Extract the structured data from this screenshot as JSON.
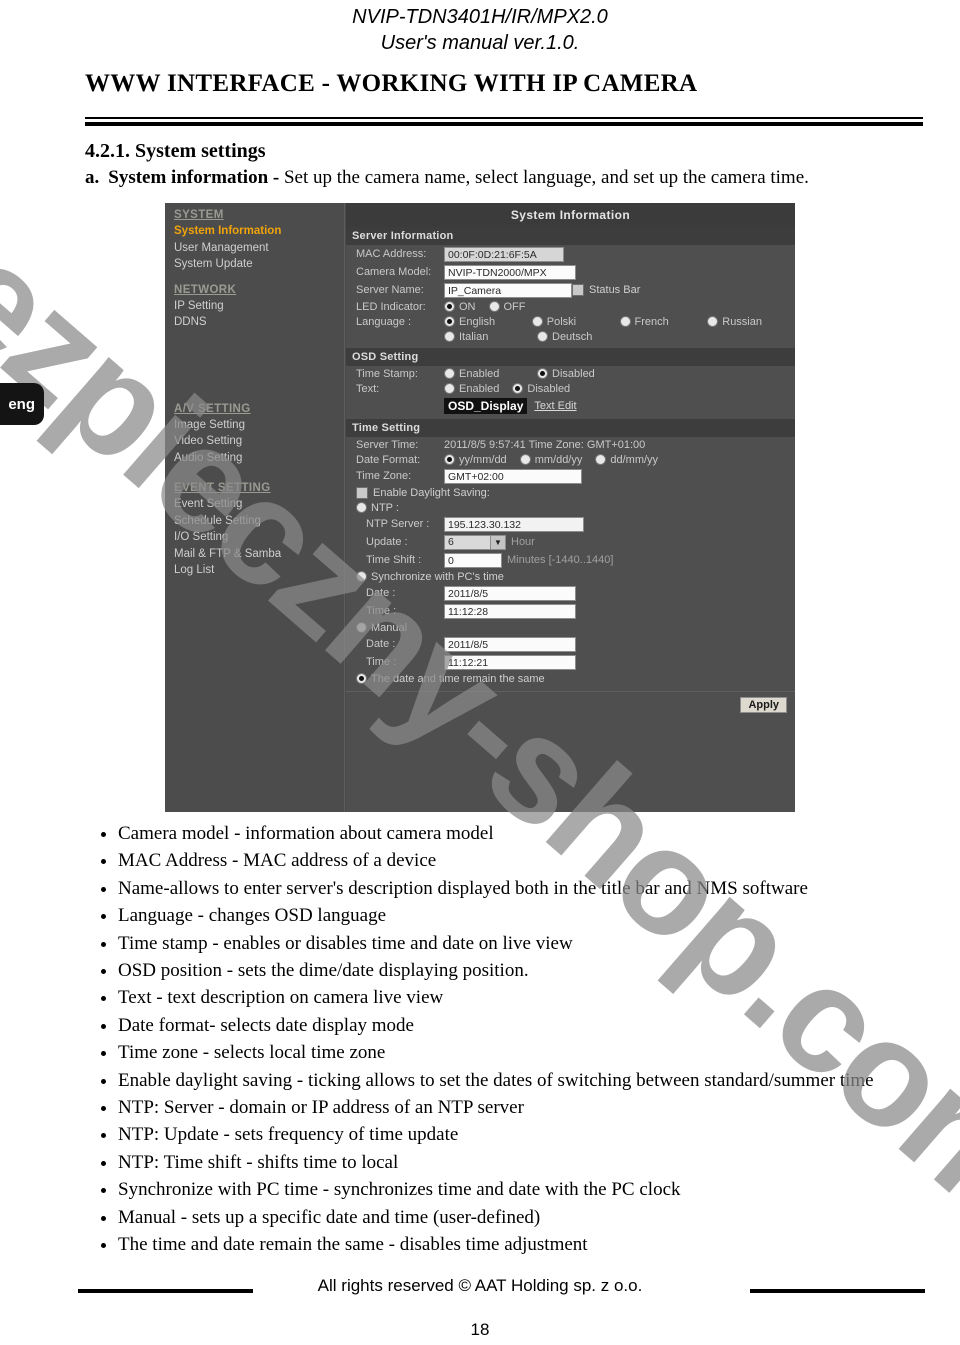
{
  "document": {
    "header_line1": "NVIP-TDN3401H/IR/MPX2.0",
    "header_line2": "User's manual ver.1.0.",
    "main_title": "WWW INTERFACE - WORKING WITH IP CAMERA",
    "section_number": "4.2.1. System settings",
    "sub_item_letter": "a.",
    "sub_item_label": "System information -",
    "sub_item_text": "Set up the camera name, select language, and set up the camera time.",
    "language_tab": "eng",
    "watermark": "bezpieczny-shop.com",
    "footer_text": "All rights reserved © AAT Holding sp. z o.o.",
    "page_number": "18"
  },
  "screenshot": {
    "sidebar": [
      {
        "label": "SYSTEM",
        "type": "group"
      },
      {
        "label": "System Information",
        "type": "item",
        "active": true
      },
      {
        "label": "User Management",
        "type": "item",
        "active": false
      },
      {
        "label": "System Update",
        "type": "item",
        "active": false
      },
      {
        "label": "NETWORK",
        "type": "group"
      },
      {
        "label": "IP Setting",
        "type": "item",
        "active": false
      },
      {
        "label": "DDNS",
        "type": "item",
        "active": false
      },
      {
        "label": "A/V SETTING",
        "type": "group"
      },
      {
        "label": "Image Setting",
        "type": "item",
        "active": false
      },
      {
        "label": "Video Setting",
        "type": "item",
        "active": false
      },
      {
        "label": "Audio Setting",
        "type": "item",
        "active": false
      },
      {
        "label": "EVENT SETTING",
        "type": "group"
      },
      {
        "label": "Event Setting",
        "type": "item",
        "active": false
      },
      {
        "label": "Schedule Setting",
        "type": "item",
        "active": false
      },
      {
        "label": "I/O Setting",
        "type": "item",
        "active": false
      },
      {
        "label": "Mail & FTP & Samba",
        "type": "item",
        "active": false
      },
      {
        "label": "Log List",
        "type": "item",
        "active": false
      }
    ],
    "panel_title": "System Information",
    "server_information": {
      "section_label": "Server Information",
      "mac_address_label": "MAC Address:",
      "mac_address_value": "00:0F:0D:21:6F:5A",
      "camera_model_label": "Camera Model:",
      "camera_model_value": "NVIP-TDN2000/MPX",
      "server_name_label": "Server Name:",
      "server_name_value": "IP_Camera",
      "status_bar_label": "Status Bar",
      "status_bar_checked": false,
      "led_indicator_label": "LED Indicator:",
      "led_on_label": "ON",
      "led_off_label": "OFF",
      "led_selected": "ON",
      "language_label": "Language :",
      "language_options": [
        "English",
        "Polski",
        "French",
        "Russian",
        "Italian",
        "Deutsch"
      ],
      "language_selected": "English"
    },
    "osd_setting": {
      "section_label": "OSD Setting",
      "time_stamp_label": "Time Stamp:",
      "time_stamp_enabled_label": "Enabled",
      "time_stamp_disabled_label": "Disabled",
      "time_stamp_selected": "Disabled",
      "text_label": "Text:",
      "text_enabled_label": "Enabled",
      "text_disabled_label": "Disabled",
      "text_selected": "Disabled",
      "osd_display_value": "OSD_Display",
      "text_edit_label": "Text Edit"
    },
    "time_setting": {
      "section_label": "Time Setting",
      "server_time_label": "Server Time:",
      "server_time_value": "2011/8/5 9:57:41 Time Zone: GMT+01:00",
      "date_format_label": "Date Format:",
      "date_format_options": [
        "yy/mm/dd",
        "mm/dd/yy",
        "dd/mm/yy"
      ],
      "date_format_selected": "yy/mm/dd",
      "time_zone_label": "Time Zone:",
      "time_zone_value": "GMT+02:00",
      "daylight_saving_label": "Enable Daylight Saving:",
      "daylight_saving_checked": false,
      "ntp_label": "NTP :",
      "ntp_selected": false,
      "ntp_server_label": "NTP Server :",
      "ntp_server_value": "195.123.30.132",
      "update_label": "Update :",
      "update_value": "6",
      "update_unit": "Hour",
      "time_shift_label": "Time Shift :",
      "time_shift_value": "0",
      "time_shift_unit": "Minutes  [-1440..1440]",
      "sync_pc_label": "Synchronize with PC's time",
      "sync_pc_selected": false,
      "sync_date_label": "Date :",
      "sync_date_value": "2011/8/5",
      "sync_time_label": "Time :",
      "sync_time_value": "11:12:28",
      "manual_label": "Manual",
      "manual_selected": false,
      "manual_date_label": "Date :",
      "manual_date_value": "2011/8/5",
      "manual_time_label": "Time :",
      "manual_time_value": "11:12:21",
      "remain_same_label": "The date and time remain the same",
      "remain_same_selected": true
    },
    "apply_label": "Apply"
  },
  "bullets": [
    "Camera model - information about camera model",
    "MAC Address - MAC address of a device",
    "Name-allows to enter server's description displayed both in the title bar and NMS software",
    "Language - changes OSD language",
    "Time stamp - enables or disables time and date on live view",
    "OSD position - sets the dime/date displaying position.",
    "Text - text description on camera live view",
    "Date format- selects date display mode",
    "Time zone - selects local time zone",
    "Enable daylight saving - ticking allows to set the dates of switching between standard/summer time",
    "NTP: Server - domain or IP address of an NTP server",
    "NTP: Update - sets frequency of time update",
    "NTP: Time shift - shifts time to local",
    "Synchronize with PC time - synchronizes time and date with the PC clock",
    "Manual - sets up a specific date and time (user-defined)",
    "The time and date remain the same - disables time adjustment"
  ]
}
